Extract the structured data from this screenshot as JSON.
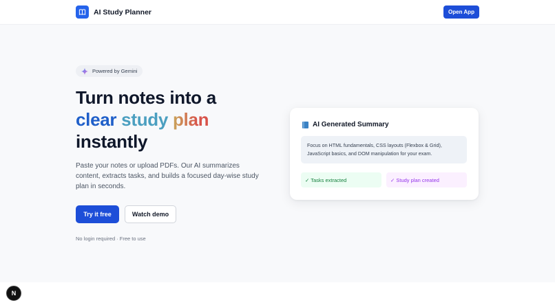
{
  "header": {
    "brand": "AI Study Planner",
    "logo_icon": "book-icon",
    "open_app_label": "Open App"
  },
  "hero": {
    "badge": "Powered by Gemini",
    "badge_icon": "sparkle-icon",
    "headline_line1": "Turn notes into a",
    "headline_words": [
      "clear",
      "study",
      "plan"
    ],
    "headline_line3": "instantly",
    "subtext": "Paste your notes or upload PDFs. Our AI summarizes content, extracts tasks, and builds a focused day-wise study plan in seconds.",
    "try_label": "Try it free",
    "demo_label": "Watch demo",
    "note": "No login required · Free to use"
  },
  "card": {
    "title": "AI Generated Summary",
    "title_icon": "blue-book-icon",
    "summary": "Focus on HTML fundamentals, CSS layouts (Flexbox & Grid), JavaScript basics, and DOM manipulation for your exam.",
    "pill_tasks": "✓ Tasks extracted",
    "pill_plan": "✓ Study plan created"
  },
  "devtools": {
    "badge_letter": "N"
  },
  "colors": {
    "primary": "#1d4ed8",
    "hero_bg": "#f8f9fb",
    "word_clear": "#1f5fc9",
    "word_study": "#4b9fc0",
    "word_plan": "#d8534a",
    "pill_green": "#15803d",
    "pill_purple": "#9333ea"
  }
}
